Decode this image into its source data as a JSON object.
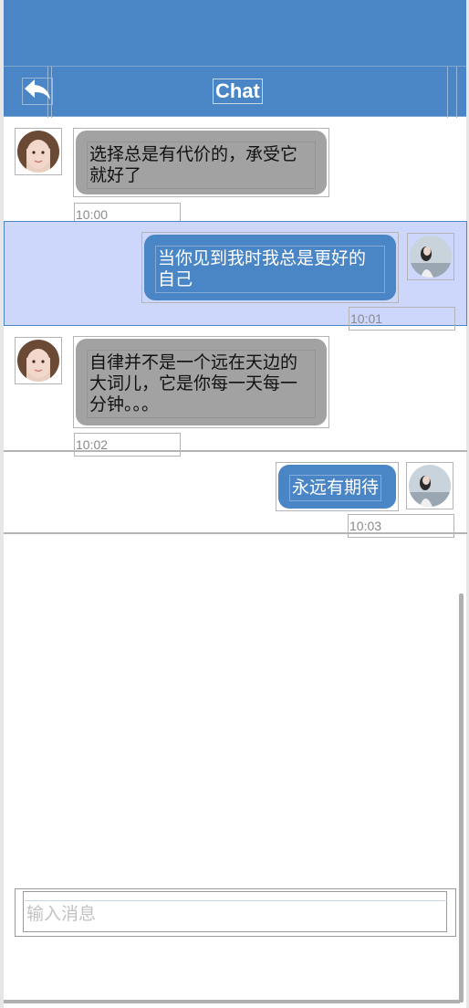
{
  "header": {
    "title": "Chat",
    "back_icon": "back-arrow-icon"
  },
  "colors": {
    "accent": "#4a86c5",
    "incoming_bubble": "#a2a2a2",
    "selected_row": "#cdd6fb"
  },
  "messages": [
    {
      "side": "left",
      "text": "选择总是有代价的，承受它就好了",
      "time": "10:00",
      "avatar": "avatar-female"
    },
    {
      "side": "right",
      "text": "当你见到我时我总是更好的自己",
      "time": "10:01",
      "avatar": "avatar-self",
      "selected": true
    },
    {
      "side": "left",
      "text": "自律并不是一个远在天边的大词儿，它是你每一天每一分钟。。。",
      "time": "10:02",
      "avatar": "avatar-female"
    },
    {
      "side": "right",
      "text": "永远有期待",
      "time": "10:03",
      "avatar": "avatar-self"
    }
  ],
  "composer": {
    "placeholder": "输入消息",
    "value": ""
  }
}
